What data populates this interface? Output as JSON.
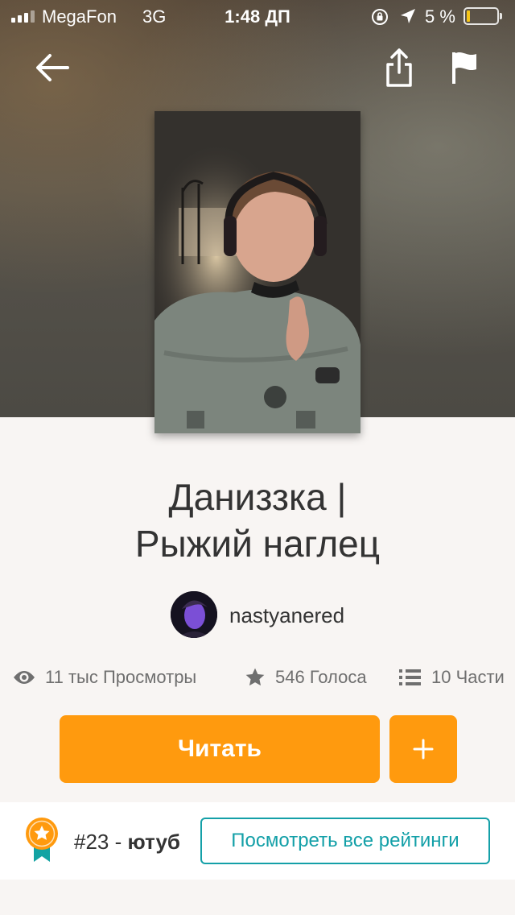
{
  "status_bar": {
    "carrier": "MegaFon",
    "network": "3G",
    "time": "1:48 ДП",
    "battery_percent": "5 %",
    "battery_level": 0.05
  },
  "story": {
    "title_line1": "Даниззка |",
    "title_line2": "Рыжий наглец",
    "author": "nastyanered"
  },
  "stats": {
    "views": "11 тыс Просмотры",
    "votes": "546 Голоса",
    "parts": "10 Части"
  },
  "actions": {
    "read_label": "Читать",
    "add_label": "+"
  },
  "ranking": {
    "position": "#23 -",
    "tag": "ютуб",
    "see_all_label": "Посмотреть все рейтинги"
  },
  "colors": {
    "accent": "#ff9a0e",
    "teal": "#14a0a8",
    "background": "#f8f5f3"
  },
  "icons": [
    "back-arrow-icon",
    "share-icon",
    "flag-icon",
    "eye-icon",
    "star-icon",
    "list-icon",
    "ranking-badge-icon"
  ]
}
